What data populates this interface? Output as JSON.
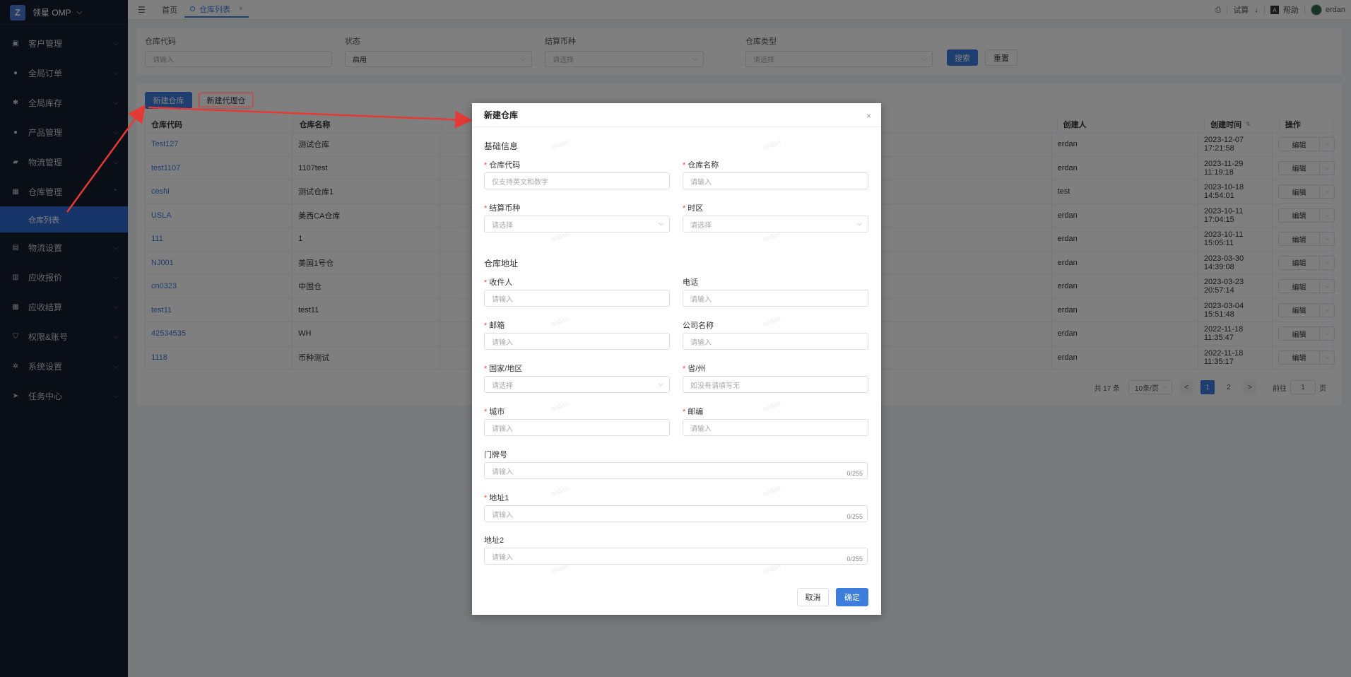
{
  "app": {
    "brand": "领星 OMP",
    "brand_letter": "Z"
  },
  "sidebar": {
    "items": [
      {
        "label": "客户管理",
        "icon": "customer-icon"
      },
      {
        "label": "全局订单",
        "icon": "user-icon"
      },
      {
        "label": "全局库存",
        "icon": "settings-icon"
      },
      {
        "label": "产品管理",
        "icon": "user-icon"
      },
      {
        "label": "物流管理",
        "icon": "truck-icon"
      },
      {
        "label": "仓库管理",
        "icon": "warehouse-icon"
      },
      {
        "label": "物流设置",
        "icon": "box-icon"
      },
      {
        "label": "应收报价",
        "icon": "document-icon"
      },
      {
        "label": "应收结算",
        "icon": "calculator-icon"
      },
      {
        "label": "权限&账号",
        "icon": "shield-icon"
      },
      {
        "label": "系统设置",
        "icon": "gear-icon"
      },
      {
        "label": "任务中心",
        "icon": "send-icon"
      }
    ],
    "active_sub": "仓库列表"
  },
  "topbar": {
    "home_tab": "首页",
    "active_tab": "仓库列表",
    "trial": "试算",
    "help": "帮助",
    "user": "erdan"
  },
  "filters": {
    "code_label": "仓库代码",
    "code_placeholder": "请输入",
    "status_label": "状态",
    "status_value": "启用",
    "currency_label": "结算币种",
    "currency_placeholder": "请选择",
    "type_label": "仓库类型",
    "type_placeholder": "请选择",
    "search_btn": "搜索",
    "reset_btn": "重置"
  },
  "toolbar": {
    "new_warehouse": "新建仓库",
    "new_agent": "新建代理仓"
  },
  "table": {
    "headers": {
      "code": "仓库代码",
      "name": "仓库名称",
      "creator": "创建人",
      "time": "创建时间",
      "op": "操作"
    },
    "edit_label": "编辑",
    "rows": [
      {
        "code": "Test127",
        "name": "测试仓库",
        "creator": "erdan",
        "time": "2023-12-07 17:21:58"
      },
      {
        "code": "test1107",
        "name": "1107test",
        "creator": "erdan",
        "time": "2023-11-29 11:19:18"
      },
      {
        "code": "ceshi",
        "name": "测试仓库1",
        "creator": "test",
        "time": "2023-10-18 14:54:01"
      },
      {
        "code": "USLA",
        "name": "美西CA仓库",
        "creator": "erdan",
        "time": "2023-10-11 17:04:15"
      },
      {
        "code": "111",
        "name": "1",
        "creator": "erdan",
        "time": "2023-10-11 15:05:11"
      },
      {
        "code": "NJ001",
        "name": "美国1号仓",
        "creator": "erdan",
        "time": "2023-03-30 14:39:08"
      },
      {
        "code": "cn0323",
        "name": "中国仓",
        "creator": "erdan",
        "time": "2023-03-23 20:57:14"
      },
      {
        "code": "test11",
        "name": "test11",
        "creator": "erdan",
        "time": "2023-03-04 15:51:48"
      },
      {
        "code": "42534535",
        "name": "WH",
        "creator": "erdan",
        "time": "2022-11-18 11:35:47"
      },
      {
        "code": "1118",
        "name": "币种测试",
        "creator": "erdan",
        "time": "2022-11-18 11:35:17"
      }
    ]
  },
  "pager": {
    "total": "共 17 条",
    "page_size": "10条/页",
    "prev": "<",
    "page1": "1",
    "page2": "2",
    "next": ">",
    "goto": "前往",
    "goto_value": "1",
    "page_unit": "页"
  },
  "modal": {
    "title": "新建仓库",
    "basic_section": "基础信息",
    "address_section": "仓库地址",
    "fields": {
      "code": {
        "label": "仓库代码",
        "placeholder": "仅支持英文和数字"
      },
      "name": {
        "label": "仓库名称",
        "placeholder": "请输入"
      },
      "currency": {
        "label": "结算币种",
        "placeholder": "请选择"
      },
      "timezone": {
        "label": "时区",
        "placeholder": "请选择"
      },
      "receiver": {
        "label": "收件人",
        "placeholder": "请输入"
      },
      "phone": {
        "label": "电话",
        "placeholder": "请输入"
      },
      "email": {
        "label": "邮箱",
        "placeholder": "请输入"
      },
      "company": {
        "label": "公司名称",
        "placeholder": "请输入"
      },
      "country": {
        "label": "国家/地区",
        "placeholder": "请选择"
      },
      "state": {
        "label": "省/州",
        "placeholder": "如没有请填写无"
      },
      "city": {
        "label": "城市",
        "placeholder": "请输入"
      },
      "zip": {
        "label": "邮编",
        "placeholder": "请输入"
      },
      "house_no": {
        "label": "门牌号",
        "placeholder": "请输入",
        "counter": "0/255"
      },
      "address1": {
        "label": "地址1",
        "placeholder": "请输入",
        "counter": "0/255"
      },
      "address2": {
        "label": "地址2",
        "placeholder": "请输入",
        "counter": "0/255"
      }
    },
    "cancel_btn": "取消",
    "confirm_btn": "确定"
  },
  "colors": {
    "primary": "#3b7cdc",
    "sidebar_bg": "#141c2e",
    "annotation": "#e53935"
  }
}
